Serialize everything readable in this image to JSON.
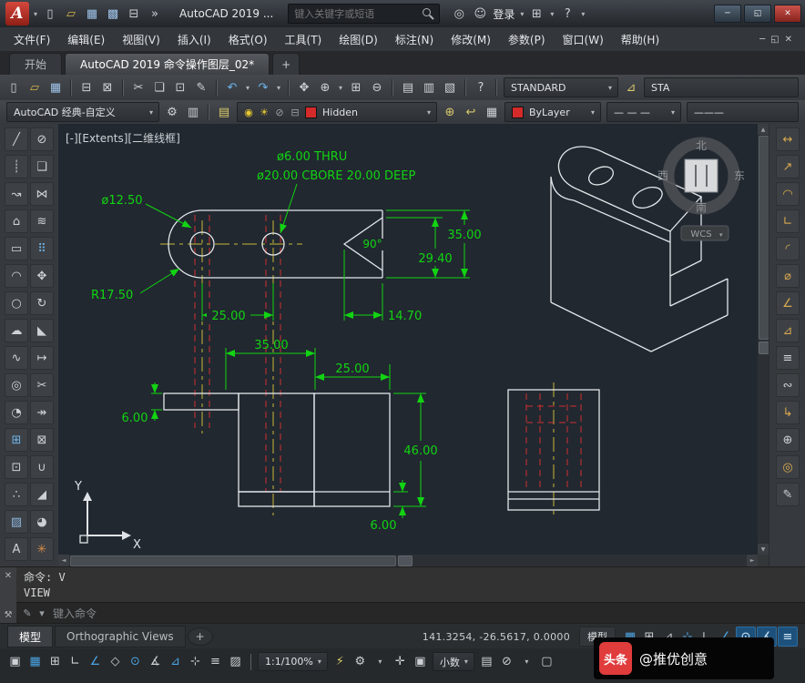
{
  "glyphs": {
    "caret": "▾",
    "close": "✕",
    "min": "─",
    "restore": "◱",
    "up": "▲",
    "down": "▼",
    "left": "◄",
    "right": "►",
    "wrench": "⚒",
    "pencil": "✎",
    "logo": "A",
    "x_close": "✕"
  },
  "titlebar": {
    "app_title": "AutoCAD 2019 ...",
    "search_placeholder": "键入关键字或短语",
    "signin": "登录"
  },
  "menubar": {
    "items": [
      "文件(F)",
      "编辑(E)",
      "视图(V)",
      "插入(I)",
      "格式(O)",
      "工具(T)",
      "绘图(D)",
      "标注(N)",
      "修改(M)",
      "参数(P)",
      "窗口(W)",
      "帮助(H)"
    ]
  },
  "filetabs": {
    "start": "开始",
    "active": "AutoCAD 2019 命令操作图层_02*",
    "add": "+"
  },
  "toolbar": {
    "standard": "STANDARD",
    "standard_cut": "STA",
    "workspace": "AutoCAD 经典-自定义",
    "layer": "Hidden",
    "color": "ByLayer",
    "linetype_sample": "— — —",
    "lineweight_sample": "———"
  },
  "canvas": {
    "viewport": "[-][Extents][二维线框]",
    "viewcube": {
      "n": "北",
      "s": "南",
      "w": "西",
      "e": "东",
      "wcs": "WCS"
    },
    "ucs": {
      "x": "X",
      "y": "Y"
    },
    "dims": {
      "thru": "ø6.00 THRU",
      "cbore": "ø20.00 CBORE 20.00 DEEP",
      "d125": "ø12.50",
      "r175": "R17.50",
      "h35": "35.00",
      "h294": "29.40",
      "a90": "90°",
      "w25": "25.00",
      "w147": "14.70",
      "f35": "35.00",
      "f25": "25.00",
      "f6l": "6.00",
      "f46": "46.00",
      "f6b": "6.00"
    }
  },
  "command": {
    "l1": "命令: V",
    "l2": "VIEW",
    "prompt": "键入命令"
  },
  "layout": {
    "model": "模型",
    "tab2": "Orthographic Views",
    "add": "+"
  },
  "status": {
    "coords": "141.3254, -26.5617, 0.0000",
    "model": "模型",
    "scale": "1:1/100%",
    "units": "小数"
  },
  "watermark": {
    "logo": "头条",
    "text": "@推优创意"
  },
  "colors": {
    "layer_red": "#d42a2a",
    "dim_green": "#12d412",
    "centerline_yellow": "#c9b637",
    "hidden_red": "#d03030",
    "canvas_bg": "#212830"
  },
  "icons": {
    "quick": [
      {
        "n": "qnew-icon",
        "g": "▯"
      },
      {
        "n": "qopen-icon",
        "g": "▱",
        "c": "#d9b44a"
      },
      {
        "n": "qsave-icon",
        "g": "▦",
        "c": "#9fc3e8"
      },
      {
        "n": "qsaveas-icon",
        "g": "▩",
        "c": "#9fc3e8"
      },
      {
        "n": "qplot-icon",
        "g": "⊟"
      },
      {
        "n": "toolbar-overflow-icon",
        "g": "»"
      }
    ],
    "acct1": [
      {
        "n": "a360-icon",
        "g": "◎"
      },
      {
        "n": "user-icon",
        "g": "☺"
      }
    ],
    "acct2": [
      {
        "n": "app-store-icon",
        "g": "⊞"
      },
      {
        "n": "store-caret-icon",
        "g": "▾",
        "k": "car"
      },
      {
        "n": "help-icon",
        "g": "?"
      },
      {
        "n": "help-caret-icon",
        "g": "▾",
        "k": "car"
      }
    ],
    "toolbar1": [
      {
        "n": "new-icon",
        "g": "▯"
      },
      {
        "n": "open-icon",
        "g": "▱",
        "c": "#d9b44a"
      },
      {
        "n": "save-icon",
        "g": "▦",
        "c": "#9fc3e8"
      },
      {
        "sep": true
      },
      {
        "n": "plot-icon",
        "g": "⊟"
      },
      {
        "n": "plot-preview-icon",
        "g": "⊠"
      },
      {
        "sep": true
      },
      {
        "n": "cut-icon",
        "g": "✂"
      },
      {
        "n": "copy-icon",
        "g": "❏"
      },
      {
        "n": "paste-icon",
        "g": "⊡"
      },
      {
        "n": "match-properties-icon",
        "g": "✎"
      },
      {
        "sep": true
      },
      {
        "n": "undo-icon",
        "g": "↶",
        "c": "#6fb3e8"
      },
      {
        "n": "undo-caret-icon",
        "g": "▾",
        "k": "car"
      },
      {
        "n": "redo-icon",
        "g": "↷",
        "c": "#6fb3e8"
      },
      {
        "n": "redo-caret-icon",
        "g": "▾",
        "k": "car"
      },
      {
        "sep": true
      },
      {
        "n": "pan-icon",
        "g": "✥"
      },
      {
        "n": "zoom-realtime-icon",
        "g": "⊕"
      },
      {
        "n": "zoom-caret-icon",
        "g": "▾",
        "k": "car"
      },
      {
        "n": "zoom-window-icon",
        "g": "⊞"
      },
      {
        "n": "zoom-previous-icon",
        "g": "⊖"
      },
      {
        "sep": true
      },
      {
        "n": "properties-icon",
        "g": "▤"
      },
      {
        "n": "designcenter-icon",
        "g": "▥"
      },
      {
        "n": "tool-palettes-icon",
        "g": "▧"
      },
      {
        "sep": true
      },
      {
        "n": "help-question-icon",
        "g": "?"
      },
      {
        "sep": true
      }
    ],
    "toolbar1b": [
      {
        "n": "annotation-align-icon",
        "g": "⊿",
        "c": "#d9c86a"
      }
    ],
    "tb2a": [
      {
        "n": "workspace-gear-icon",
        "g": "⚙"
      },
      {
        "n": "workspace-settings-icon",
        "g": "▥"
      },
      {
        "sep": true
      },
      {
        "n": "layer-properties-icon",
        "g": "▤",
        "c": "#d9c86a"
      }
    ],
    "layerbits": [
      {
        "n": "layer-on-bulb-icon",
        "g": "◉",
        "c": "#e8c832"
      },
      {
        "n": "layer-freeze-sun-icon",
        "g": "☀",
        "c": "#e8c832"
      },
      {
        "n": "layer-lock-icon",
        "g": "⊘",
        "c": "#9aa0a4"
      },
      {
        "n": "layer-plot-icon",
        "g": "⊟",
        "c": "#9aa0a4"
      }
    ],
    "tb2b": [
      {
        "n": "make-layer-current-icon",
        "g": "⊕",
        "c": "#d9c86a"
      },
      {
        "n": "layer-previous-icon",
        "g": "↩",
        "c": "#d9c86a"
      },
      {
        "n": "layer-states-icon",
        "g": "▦"
      }
    ],
    "draw": [
      {
        "n": "line-tool-icon",
        "g": "╱"
      },
      {
        "n": "construction-line-icon",
        "g": "┊"
      },
      {
        "n": "polyline-icon",
        "g": "↝"
      },
      {
        "n": "polygon-icon",
        "g": "⌂"
      },
      {
        "n": "rectangle-icon",
        "g": "▭"
      },
      {
        "n": "arc-icon",
        "g": "◠"
      },
      {
        "n": "circle-icon",
        "g": "○"
      },
      {
        "n": "revision-cloud-icon",
        "g": "☁"
      },
      {
        "n": "spline-icon",
        "g": "∿"
      },
      {
        "n": "ellipse-icon",
        "g": "◎"
      },
      {
        "n": "ellipse-arc-icon",
        "g": "◔"
      },
      {
        "n": "insert-block-icon",
        "g": "⊞",
        "c": "#6fb3e8"
      },
      {
        "n": "make-block-icon",
        "g": "⊡"
      },
      {
        "n": "point-icon",
        "g": "∴"
      },
      {
        "n": "hatch-icon",
        "g": "▨",
        "c": "#8fb6e0"
      },
      {
        "n": "mtext-icon",
        "g": "A"
      }
    ],
    "modify": [
      {
        "n": "erase-icon",
        "g": "⊘"
      },
      {
        "n": "copy-object-icon",
        "g": "❏"
      },
      {
        "n": "mirror-icon",
        "g": "⋈"
      },
      {
        "n": "offset-icon",
        "g": "≋"
      },
      {
        "n": "array-icon",
        "g": "⠿",
        "c": "#6fb3e8"
      },
      {
        "n": "move-icon",
        "g": "✥"
      },
      {
        "n": "rotate-icon",
        "g": "↻"
      },
      {
        "n": "scale-icon",
        "g": "◣"
      },
      {
        "n": "stretch-icon",
        "g": "↦"
      },
      {
        "n": "trim-icon",
        "g": "✂"
      },
      {
        "n": "extend-icon",
        "g": "↠"
      },
      {
        "n": "break-icon",
        "g": "⊠"
      },
      {
        "n": "join-icon",
        "g": "∪"
      },
      {
        "n": "chamfer-icon",
        "g": "◢"
      },
      {
        "n": "fillet-icon",
        "g": "◕"
      },
      {
        "n": "explode-icon",
        "g": "✳",
        "c": "#d98c4a"
      }
    ],
    "dimension": [
      {
        "n": "dim-linear-icon",
        "g": "↔",
        "c": "#d9a94f"
      },
      {
        "n": "dim-aligned-icon",
        "g": "↗",
        "c": "#d9a94f"
      },
      {
        "n": "dim-arc-length-icon",
        "g": "◠",
        "c": "#d9a94f"
      },
      {
        "n": "dim-ordinate-icon",
        "g": "∟",
        "c": "#d9a94f"
      },
      {
        "n": "dim-radius-icon",
        "g": "◜",
        "c": "#d9a94f"
      },
      {
        "n": "dim-diameter-icon",
        "g": "⌀",
        "c": "#d9a94f"
      },
      {
        "n": "dim-angular-icon",
        "g": "∠",
        "c": "#d9a94f"
      },
      {
        "n": "quick-dim-icon",
        "g": "⊿",
        "c": "#d9a94f"
      },
      {
        "n": "dim-baseline-icon",
        "g": "≡"
      },
      {
        "n": "dim-continue-icon",
        "g": "∾"
      },
      {
        "n": "multileader-icon",
        "g": "↳",
        "c": "#d9a94f"
      },
      {
        "n": "tolerance-icon",
        "g": "⊕"
      },
      {
        "n": "center-mark-icon",
        "g": "◎",
        "c": "#d9a94f"
      },
      {
        "n": "dim-style-icon",
        "g": "✎"
      }
    ],
    "statusA": [
      {
        "n": "grid-display-icon",
        "g": "▦",
        "c": "#4aa3e3"
      },
      {
        "n": "snap-mode-icon",
        "g": "⊞"
      },
      {
        "n": "infer-constraints-icon",
        "g": "⊿"
      },
      {
        "n": "dynamic-input-icon",
        "g": "⊹",
        "c": "#4aa3e3"
      },
      {
        "n": "ortho-mode-icon",
        "g": "∟"
      },
      {
        "n": "polar-tracking-icon",
        "g": "∠",
        "c": "#4aa3e3"
      },
      {
        "n": "osnap-icon",
        "g": "⊙",
        "k": "bb"
      },
      {
        "n": "otrack-icon",
        "g": "∡",
        "k": "bb"
      },
      {
        "n": "lineweight-display-icon",
        "g": "≡",
        "k": "bb"
      }
    ],
    "statusB": [
      {
        "n": "model-paper-toggle-icon",
        "g": "▣"
      },
      {
        "n": "grid-toggle-icon",
        "g": "▦",
        "c": "#4aa3e3"
      },
      {
        "n": "snap-toggle-icon",
        "g": "⊞"
      },
      {
        "n": "ortho-toggle-icon",
        "g": "∟"
      },
      {
        "n": "polar-toggle-icon",
        "g": "∠",
        "c": "#4aa3e3"
      },
      {
        "n": "isodraft-toggle-icon",
        "g": "◇"
      },
      {
        "n": "osnap-toggle-icon",
        "g": "⊙",
        "c": "#4aa3e3"
      },
      {
        "n": "otrack-toggle-icon",
        "g": "∡"
      },
      {
        "n": "dyn-ucs-icon",
        "g": "⊿",
        "c": "#4aa3e3"
      },
      {
        "n": "dyn-input-toggle-icon",
        "g": "⊹"
      },
      {
        "n": "lineweight-toggle-icon",
        "g": "≡"
      },
      {
        "n": "transparency-toggle-icon",
        "g": "▨"
      },
      {
        "sep": true
      }
    ],
    "statusB2": [
      {
        "n": "annotation-autoscale-icon",
        "g": "⚡",
        "c": "#d9c86a"
      },
      {
        "n": "workspace-switch-icon",
        "g": "⚙"
      },
      {
        "n": "workspace-caret-icon",
        "g": "▾",
        "k": "car"
      },
      {
        "n": "crosshair-icon",
        "g": "✛"
      },
      {
        "n": "hardware-accel-icon",
        "g": "▣"
      }
    ],
    "statusB3": [
      {
        "n": "quick-properties-icon",
        "g": "▤"
      },
      {
        "n": "lock-ui-icon",
        "g": "⊘"
      },
      {
        "n": "lock-ui-caret-icon",
        "g": "▾",
        "k": "car"
      },
      {
        "n": "clean-screen-icon",
        "g": "▢"
      }
    ]
  }
}
